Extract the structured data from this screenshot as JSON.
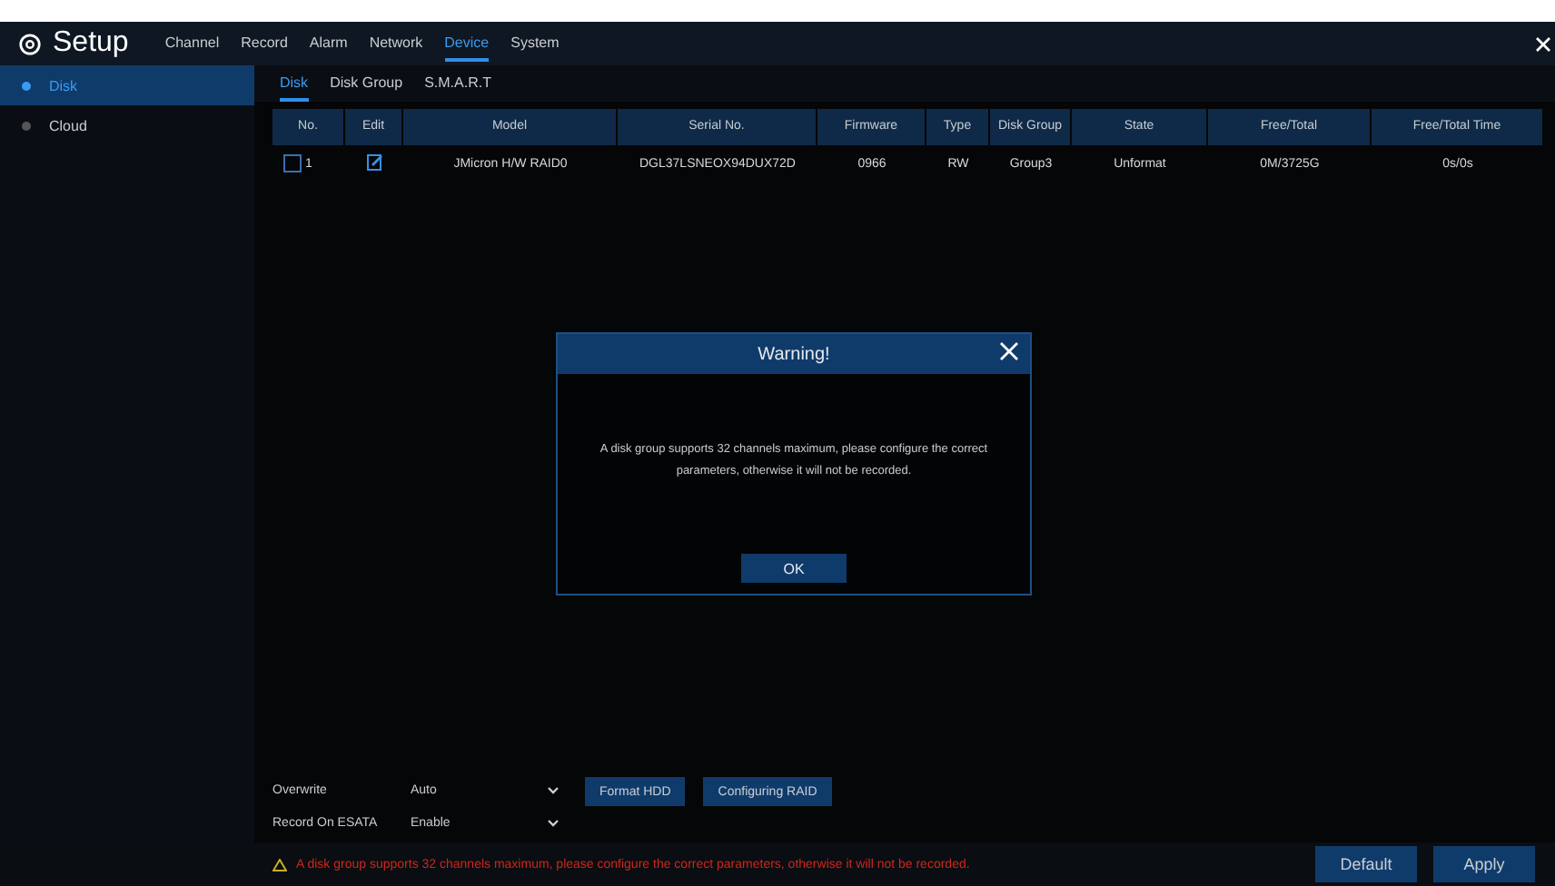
{
  "header": {
    "title": "Setup",
    "tabs": [
      {
        "label": "Channel",
        "selected": false
      },
      {
        "label": "Record",
        "selected": false
      },
      {
        "label": "Alarm",
        "selected": false
      },
      {
        "label": "Network",
        "selected": false
      },
      {
        "label": "Device",
        "selected": true
      },
      {
        "label": "System",
        "selected": false
      }
    ]
  },
  "sidebar": {
    "items": [
      {
        "label": "Disk",
        "selected": true
      },
      {
        "label": "Cloud",
        "selected": false
      }
    ]
  },
  "subtabs": [
    {
      "label": "Disk",
      "selected": true
    },
    {
      "label": "Disk Group",
      "selected": false
    },
    {
      "label": "S.M.A.R.T",
      "selected": false
    }
  ],
  "table": {
    "columns": [
      "No.",
      "Edit",
      "Model",
      "Serial No.",
      "Firmware",
      "Type",
      "Disk Group",
      "State",
      "Free/Total",
      "Free/Total Time"
    ],
    "rows": [
      {
        "checked": false,
        "no": "1",
        "model": "JMicron H/W RAID0",
        "serial": "DGL37LSNEOX94DUX72D",
        "firmware": "0966",
        "type": "RW",
        "disk_group": "Group3",
        "state": "Unformat",
        "free_total": "0M/3725G",
        "free_total_time": "0s/0s"
      }
    ]
  },
  "settings": [
    {
      "label": "Overwrite",
      "value": "Auto"
    },
    {
      "label": "Record On ESATA",
      "value": "Enable"
    }
  ],
  "actions": [
    "Format HDD",
    "Configuring RAID"
  ],
  "status_bar": {
    "message": "A disk group supports 32 channels maximum, please configure the correct parameters, otherwise it will not be recorded.",
    "buttons": [
      "Default",
      "Apply"
    ]
  },
  "dialog": {
    "title": "Warning!",
    "message": "A disk group supports 32 channels maximum, please configure the correct parameters, otherwise it will not be recorded.",
    "button": "OK"
  }
}
